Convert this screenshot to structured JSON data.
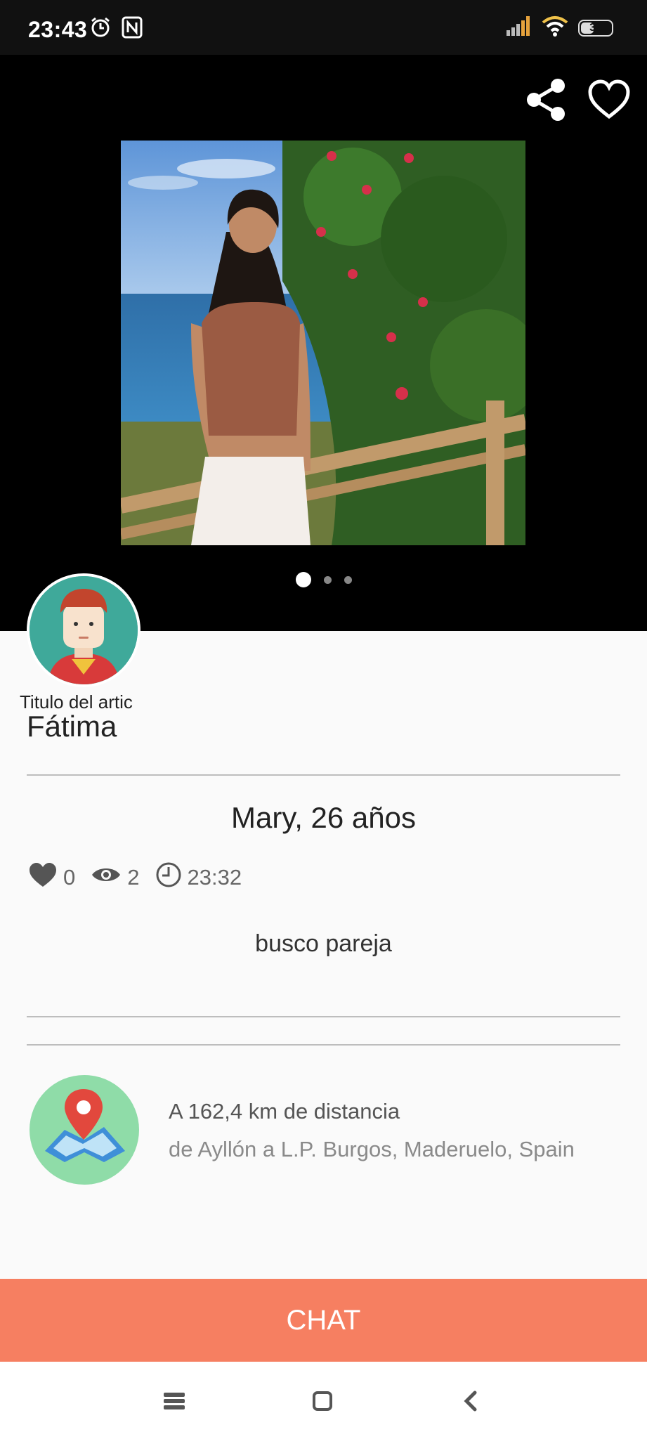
{
  "status_bar": {
    "time": "23:43",
    "battery_level": "33",
    "icons": [
      "alarm-icon",
      "nfc-icon",
      "signal-icon",
      "wifi-icon",
      "battery-icon"
    ]
  },
  "header": {
    "actions": [
      "share-icon",
      "heart-outline-icon"
    ]
  },
  "gallery": {
    "page_count": 3,
    "active_index": 0
  },
  "profile": {
    "avatar_caption": "Titulo del artic",
    "name": "Fátima"
  },
  "post": {
    "headline": "Mary, 26 años",
    "likes": "0",
    "views": "2",
    "time": "23:32",
    "description": "busco pareja"
  },
  "location": {
    "distance": "A 162,4 km de distancia",
    "place": "de Ayllón a L.P. Burgos, Maderuelo, Spain"
  },
  "actions": {
    "chat_label": "CHAT"
  },
  "colors": {
    "chat_button": "#f67f61",
    "avatar_bg": "#3fa99a",
    "map_bg": "#8fdca8",
    "gallery_bg": "#000000"
  },
  "nav_bar": [
    "menu-icon",
    "home-icon",
    "back-icon"
  ]
}
